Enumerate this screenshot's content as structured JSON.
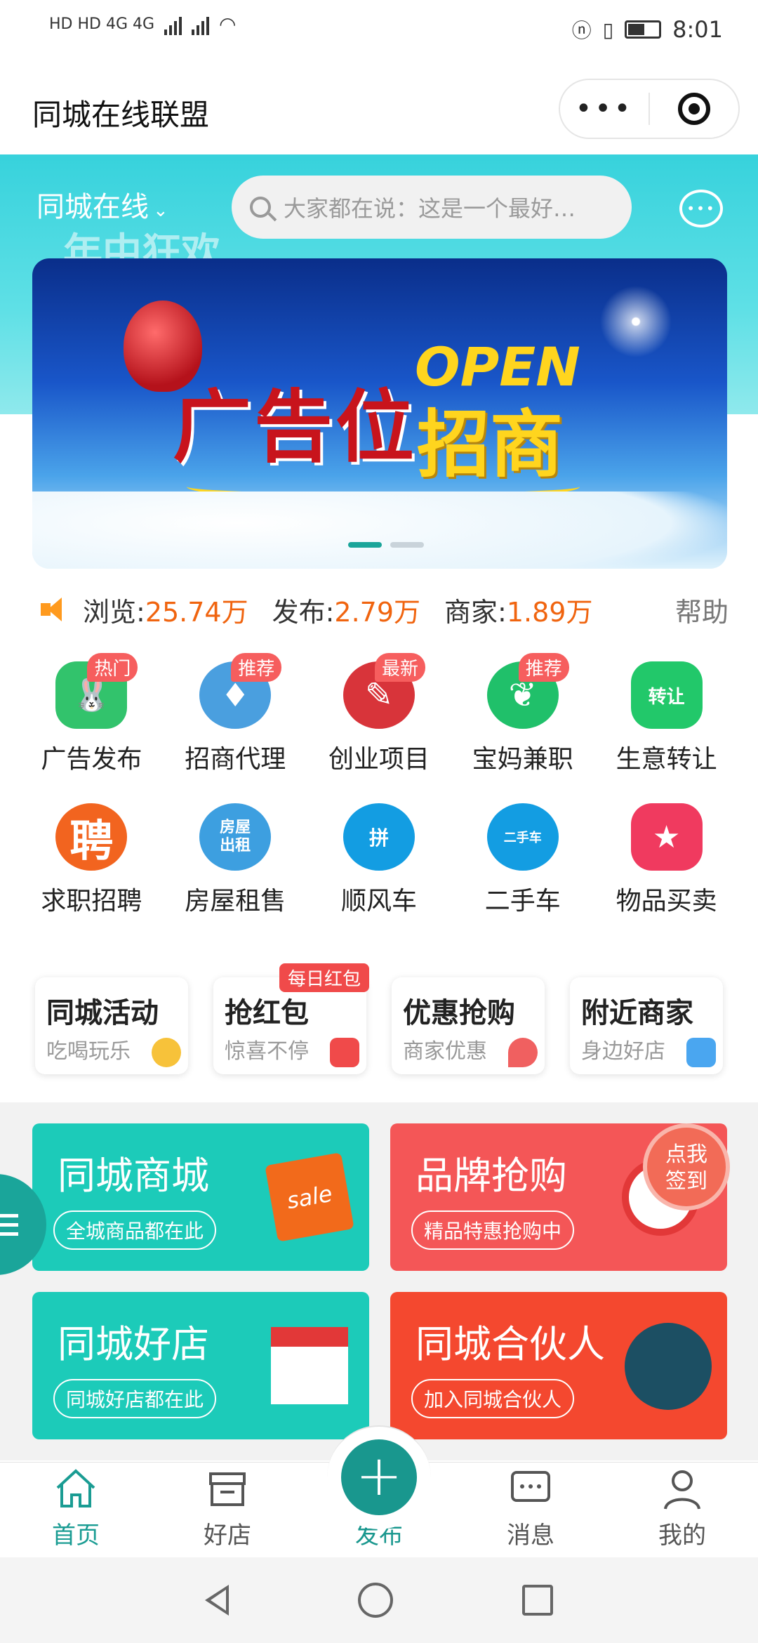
{
  "status": {
    "left_badges": "HD HD 4G 4G",
    "time": "8:01"
  },
  "header": {
    "title": "同城在线联盟",
    "more": "•••"
  },
  "hero": {
    "city": "同城在线",
    "search_placeholder": "大家都在说：这是一个最好…",
    "banner_text_1": "广告位",
    "banner_text_2": "OPEN",
    "banner_text_3": "招商"
  },
  "stats": {
    "views_label": "浏览:",
    "views": "25.74万",
    "posts_label": "发布:",
    "posts": "2.79万",
    "merchants_label": "商家:",
    "merchants": "1.89万",
    "help": "帮助"
  },
  "categories": [
    {
      "label": "广告发布",
      "badge": "热门",
      "icon": "rabbit-icon",
      "color": "#32c36c"
    },
    {
      "label": "招商代理",
      "badge": "推荐",
      "icon": "tie-icon",
      "color": "#4a9fdf"
    },
    {
      "label": "创业项目",
      "badge": "最新",
      "icon": "edit-icon",
      "color": "#d8343a"
    },
    {
      "label": "宝妈兼职",
      "badge": "推荐",
      "icon": "sprout-icon",
      "color": "#20c06a"
    },
    {
      "label": "生意转让",
      "badge": "",
      "icon": "transfer-icon",
      "glyph": "转让",
      "color": "#22c86a"
    },
    {
      "label": "求职招聘",
      "badge": "",
      "icon": "hire-icon",
      "glyph": "聘",
      "color": "#f2641f"
    },
    {
      "label": "房屋租售",
      "badge": "",
      "icon": "house-icon",
      "glyph": "房屋出租",
      "color": "#3d9fe0"
    },
    {
      "label": "顺风车",
      "badge": "",
      "icon": "carpool-icon",
      "glyph": "拼",
      "color": "#139de2"
    },
    {
      "label": "二手车",
      "badge": "",
      "icon": "used-car-icon",
      "glyph": "二手车",
      "color": "#139de2"
    },
    {
      "label": "物品买卖",
      "badge": "",
      "icon": "shop-bag-icon",
      "color": "#f03a5f"
    }
  ],
  "activities": [
    {
      "title": "同城活动",
      "sub": "吃喝玩乐",
      "tag": "",
      "color": "#f7c23a"
    },
    {
      "title": "抢红包",
      "sub": "惊喜不停",
      "tag": "每日红包",
      "color": "#f04a4a"
    },
    {
      "title": "优惠抢购",
      "sub": "商家优惠",
      "tag": "",
      "color": "#f06060"
    },
    {
      "title": "附近商家",
      "sub": "身边好店",
      "tag": "",
      "color": "#4aa6f0"
    }
  ],
  "promos": [
    {
      "title": "同城商城",
      "sub": "全城商品都在此",
      "art": "sale"
    },
    {
      "title": "品牌抢购",
      "sub": "精品特惠抢购中"
    },
    {
      "title": "同城好店",
      "sub": "同城好店都在此",
      "art": "SHOP"
    },
    {
      "title": "同城合伙人",
      "sub": "加入同城合伙人"
    }
  ],
  "signin": {
    "line1": "点我",
    "line2": "签到"
  },
  "tabs": {
    "home": "首页",
    "shops": "好店",
    "publish": "发布",
    "messages": "消息",
    "mine": "我的"
  }
}
